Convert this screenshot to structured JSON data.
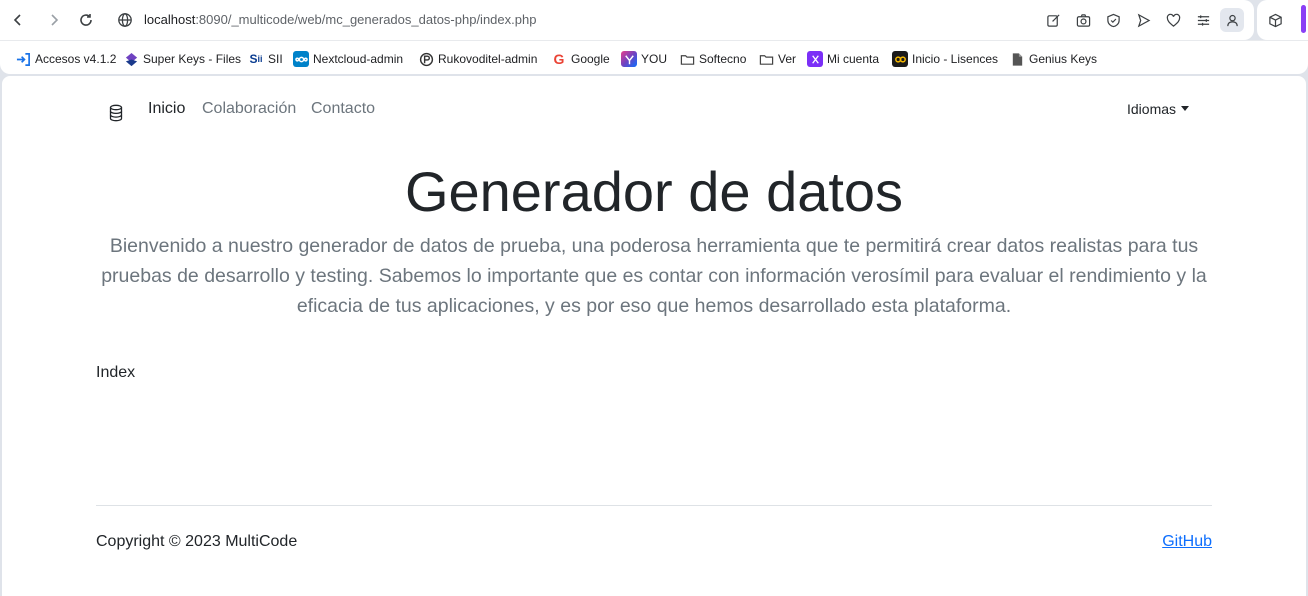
{
  "browser": {
    "url_host": "localhost",
    "url_rest": ":8090/_multicode/web/mc_generados_datos-php/index.php",
    "toolbar_icons": [
      "back-icon",
      "forward-icon",
      "reload-icon",
      "site-info-icon",
      "edit-icon",
      "screenshot-icon",
      "shield-icon",
      "send-icon",
      "heart-icon",
      "menu-icon",
      "profile-icon",
      "extension-icon"
    ]
  },
  "bookmarks": [
    {
      "label": "Accesos v4.1.2",
      "icon": "login-icon"
    },
    {
      "label": "Super Keys - Files",
      "icon": "superkeys-icon"
    },
    {
      "label": "SII",
      "icon": "sii-icon"
    },
    {
      "label": "Nextcloud-admin",
      "icon": "nextcloud-icon"
    },
    {
      "label": "Rukovoditel-admin",
      "icon": "rukovoditel-icon"
    },
    {
      "label": "Google",
      "icon": "google-icon"
    },
    {
      "label": "YOU",
      "icon": "you-icon"
    },
    {
      "label": "Softecno",
      "icon": "folder-icon"
    },
    {
      "label": "Ver",
      "icon": "folder-icon"
    },
    {
      "label": "Mi cuenta",
      "icon": "account-icon"
    },
    {
      "label": "Inicio - Lisences",
      "icon": "lisences-icon"
    },
    {
      "label": "Genius Keys",
      "icon": "file-icon"
    }
  ],
  "navbar": {
    "brand_icon": "database-icon",
    "links": [
      {
        "label": "Inicio",
        "active": true
      },
      {
        "label": "Colaboración",
        "active": false
      },
      {
        "label": "Contacto",
        "active": false
      }
    ],
    "dropdown_label": "Idiomas"
  },
  "hero": {
    "title": "Generador de datos",
    "lead": "Bienvenido a nuestro generador de datos de prueba, una poderosa herramienta que te permitirá crear datos realistas para tus pruebas de desarrollo y testing. Sabemos lo importante que es contar con información verosímil para evaluar el rendimiento y la eficacia de tus aplicaciones, y es por eso que hemos desarrollado esta plataforma."
  },
  "content": {
    "text": "Index"
  },
  "footer": {
    "copyright": "Copyright © 2023 MultiCode",
    "link": "GitHub"
  },
  "colors": {
    "link": "#0d6efd",
    "muted": "#6c757d",
    "text": "#212529"
  }
}
